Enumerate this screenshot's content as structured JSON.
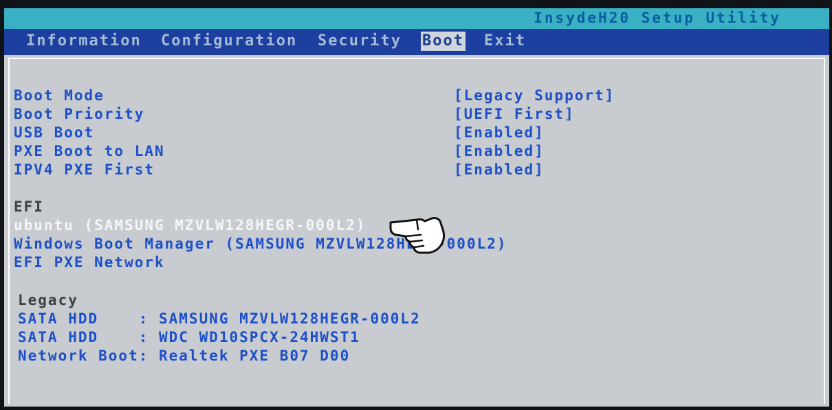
{
  "utility_title": "InsydeH20 Setup Utility",
  "tabs": [
    {
      "label": "Information"
    },
    {
      "label": "Configuration"
    },
    {
      "label": "Security"
    },
    {
      "label": "Boot"
    },
    {
      "label": "Exit"
    }
  ],
  "active_tab": "Boot",
  "settings": [
    {
      "label": "Boot Mode",
      "value": "[Legacy Support]"
    },
    {
      "label": "Boot Priority",
      "value": "[UEFI First]"
    },
    {
      "label": "USB Boot",
      "value": "[Enabled]"
    },
    {
      "label": "PXE Boot to LAN",
      "value": "[Enabled]"
    },
    {
      "label": "IPV4 PXE First",
      "value": "[Enabled]"
    }
  ],
  "efi": {
    "header": "EFI",
    "items": [
      "ubuntu (SAMSUNG MZVLW128HEGR-000L2)",
      "Windows Boot Manager (SAMSUNG MZVLW128HEGR-000L2)",
      "EFI PXE Network"
    ]
  },
  "legacy": {
    "header": "Legacy",
    "items": [
      "SATA HDD    : SAMSUNG MZVLW128HEGR-000L2",
      "SATA HDD    : WDC WD10SPCX-24HWST1",
      "Network Boot: Realtek PXE B07 D00"
    ]
  },
  "colors": {
    "screen_bg": "#c8ccd0",
    "title_bar": "#3ab0c4",
    "menu_bar": "#1c3fa0",
    "item_text": "#1c4fc8",
    "selected_text": "#f4f6f8"
  },
  "icons": {
    "pointer": "pointing-hand-icon"
  }
}
